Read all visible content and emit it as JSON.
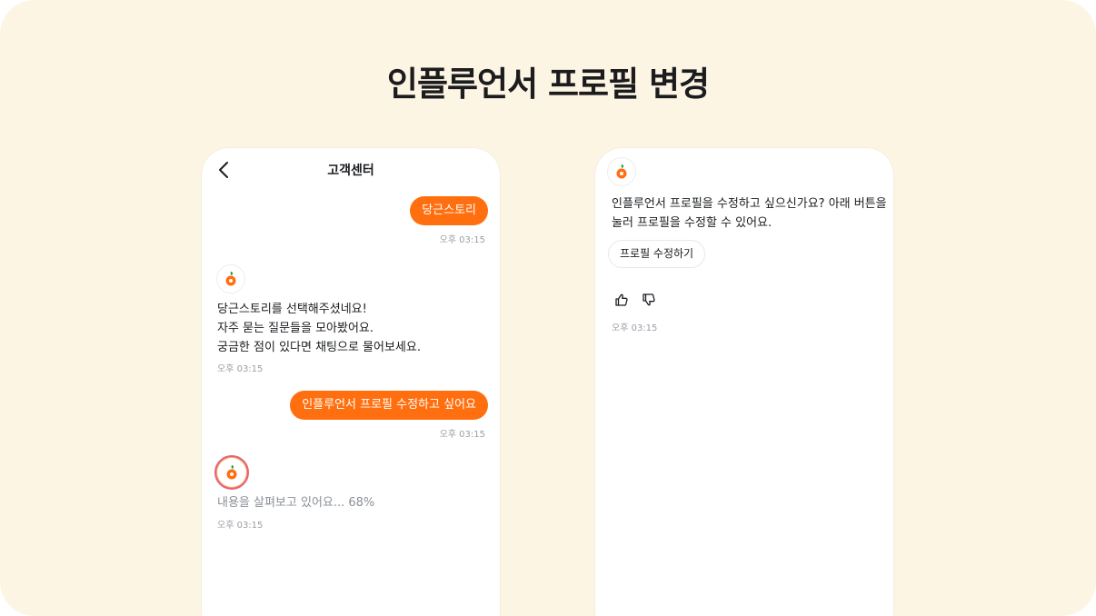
{
  "page": {
    "title": "인플루언서 프로필 변경",
    "background_color": "#fdf5e4",
    "accent_color": "#ff6f0f"
  },
  "left_phone": {
    "header": {
      "title": "고객센터",
      "back_icon": "chevron-left-icon"
    },
    "messages": [
      {
        "from": "user",
        "text": "당근스토리",
        "time": "오후 03:15"
      },
      {
        "from": "bot",
        "lines": [
          "당근스토리를 선택해주셨네요!",
          "자주 묻는 질문들을 모아봤어요.",
          "궁금한 점이 있다면 채팅으로 물어보세요."
        ],
        "time": "오후 03:15"
      },
      {
        "from": "user",
        "text": "인플루언서 프로필 수정하고 싶어요",
        "time": "오후 03:15"
      },
      {
        "from": "bot",
        "status": "내용을 살펴보고 있어요... 68%",
        "progress_percent": 68,
        "time": "오후 03:15"
      }
    ]
  },
  "right_phone": {
    "bot_message": {
      "lines": [
        "인플루언서 프로필을 수정하고 싶으신가요? 아래 버튼을",
        "눌러 프로필을 수정할 수 있어요."
      ],
      "action_button": "프로필 수정하기",
      "feedback_icons": [
        "thumbs-up-icon",
        "thumbs-down-icon"
      ],
      "time": "오후 03:15"
    }
  }
}
